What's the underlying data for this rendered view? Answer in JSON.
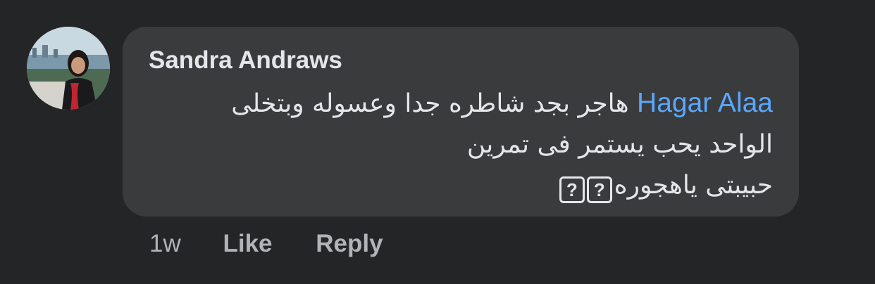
{
  "comment": {
    "author": "Sandra Andraws",
    "mention": "Hagar Alaa",
    "line1_text": "هاجر بجد شاطره جدا وعسوله وبتخلى",
    "line2_text": "الواحد يحب يستمر فى تمرين",
    "line3_text": "حبيبتى ياهجوره",
    "emoji_placeholder": "?",
    "timestamp": "1w",
    "like_label": "Like",
    "reply_label": "Reply"
  },
  "colors": {
    "background": "#242526",
    "bubble": "#3a3b3c",
    "text": "#e4e6eb",
    "mention": "#5aa7ff",
    "secondary_text": "#b0b3b8"
  },
  "icons": {
    "avatar": "profile-photo",
    "emoji_missing": "missing-glyph-box"
  }
}
